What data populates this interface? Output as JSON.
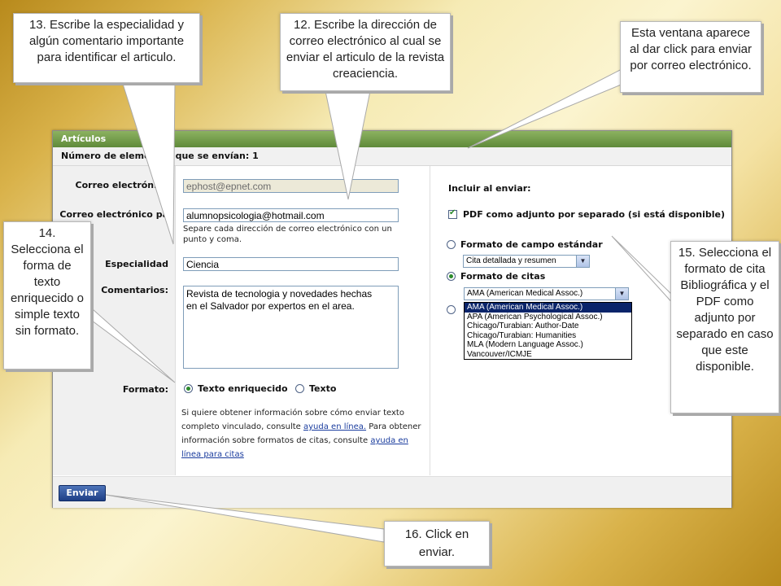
{
  "window": {
    "title": "Artículos",
    "subheader": "Número de elementos que se envían: 1"
  },
  "form": {
    "email_from_label": "Correo electrónico",
    "email_from_value": "ephost@epnet.com",
    "email_to_label": "Correo electrónico pa",
    "email_to_value": "alumnopsicologia@hotmail.com",
    "email_hint": "Separe cada dirección de correo electrónico con un punto y coma.",
    "specialty_label": "Especialidad",
    "specialty_value": "Ciencia",
    "comments_label": "Comentarios:",
    "comments_value": "Revista de tecnologia y novedades hechas\nen el Salvador por expertos en el area.",
    "format_label": "Formato:",
    "format_rich": "Texto enriquecido",
    "format_plain": "Texto",
    "info_1": "Si quiere obtener información sobre cómo enviar texto completo vinculado, consulte ",
    "info_link1": "ayuda en línea.",
    "info_2": "  Para obtener información sobre formatos de citas, consulte ",
    "info_link2": "ayuda en línea para citas"
  },
  "include": {
    "title": "Incluir al enviar:",
    "pdf_label": "PDF como adjunto por separado (si está disponible)",
    "std_format_label": "Formato de campo estándar",
    "std_select_value": "Cita detallada y resumen",
    "citation_label": "Formato de citas",
    "citation_select_value": "AMA (American Medical Assoc.)",
    "citation_options": [
      "AMA (American Medical Assoc.)",
      "APA (American Psychological Assoc.)",
      "Chicago/Turabian: Author-Date",
      "Chicago/Turabian: Humanities",
      "MLA (Modern Language Assoc.)",
      "Vancouver/ICMJE"
    ]
  },
  "footer": {
    "send_button": "Enviar"
  },
  "callouts": {
    "c13": "13. Escribe la especialidad y algún comentario importante para identificar el articulo.",
    "c12": "12. Escribe la dirección de correo electrónico al cual se enviar el articulo de la revista creaciencia.",
    "cwin": "Esta ventana aparece al dar click para enviar por correo electrónico.",
    "c14": "14. Selecciona el forma de texto enriquecido o simple texto sin formato.",
    "c15": "15. Selecciona el formato de cita Bibliográfica y el PDF como adjunto por separado en caso que este disponible.",
    "c16": "16. Click en enviar."
  },
  "colors": {
    "header_green": "#6f9a47",
    "link_blue": "#1a3c9e",
    "button_blue": "#2d4f9a",
    "highlight": "#0a246a"
  }
}
